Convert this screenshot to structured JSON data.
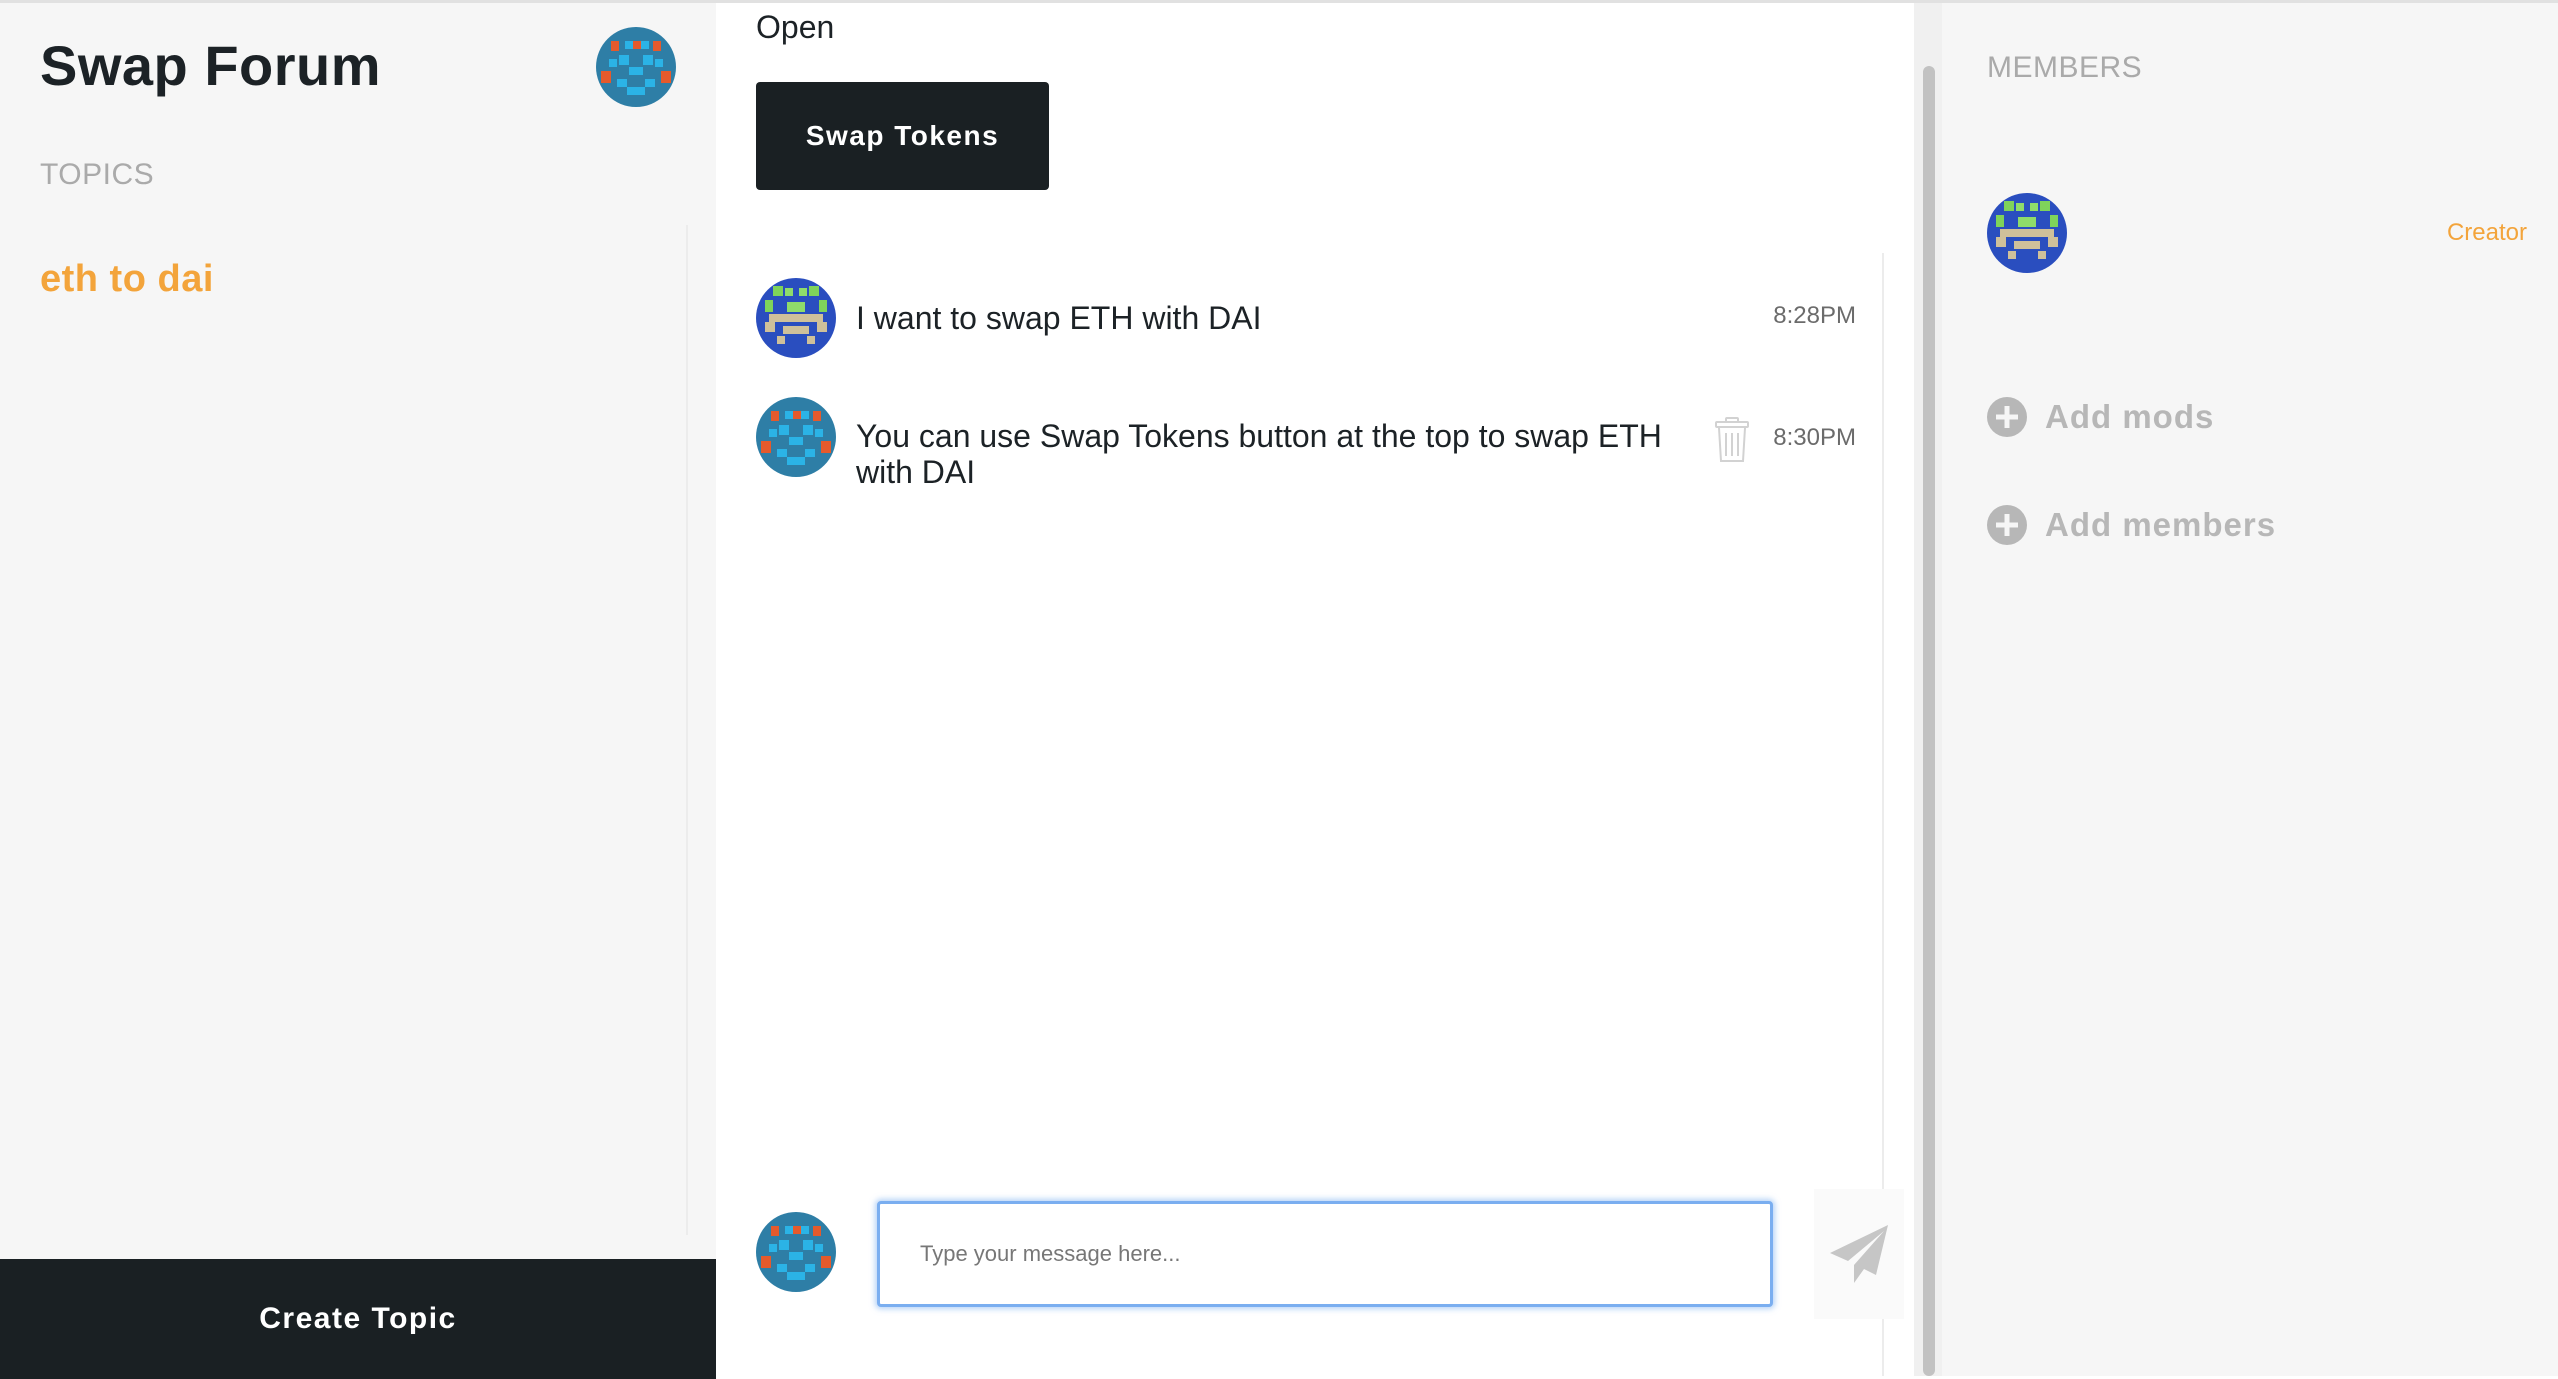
{
  "app": {
    "title": "Swap Forum"
  },
  "sidebar": {
    "topics_label": "TOPICS",
    "topics": [
      {
        "label": "eth to dai"
      }
    ],
    "create_topic_label": "Create Topic"
  },
  "topic": {
    "status": "Open",
    "swap_button_label": "Swap Tokens"
  },
  "messages": [
    {
      "text": "I want to swap ETH with DAI",
      "time": "8:28PM",
      "avatar": "pixel-avatar-green"
    },
    {
      "text": "You can use Swap Tokens button at the top to swap ETH with DAI",
      "time": "8:30PM",
      "avatar": "pixel-avatar-blue",
      "actions": [
        "trash-icon"
      ]
    }
  ],
  "compose": {
    "placeholder": "Type your message here...",
    "send_icon": "send-icon"
  },
  "members_panel": {
    "label": "MEMBERS",
    "members": [
      {
        "role": "Creator",
        "avatar": "pixel-avatar-green"
      }
    ],
    "add_mods_label": "Add mods",
    "add_members_label": "Add members"
  },
  "colors": {
    "accent": "#f3a43b",
    "dark": "#1a2023",
    "sidebar_bg": "#f6f6f6",
    "muted": "#aaaaaa",
    "input_focus": "#7aaef0"
  }
}
